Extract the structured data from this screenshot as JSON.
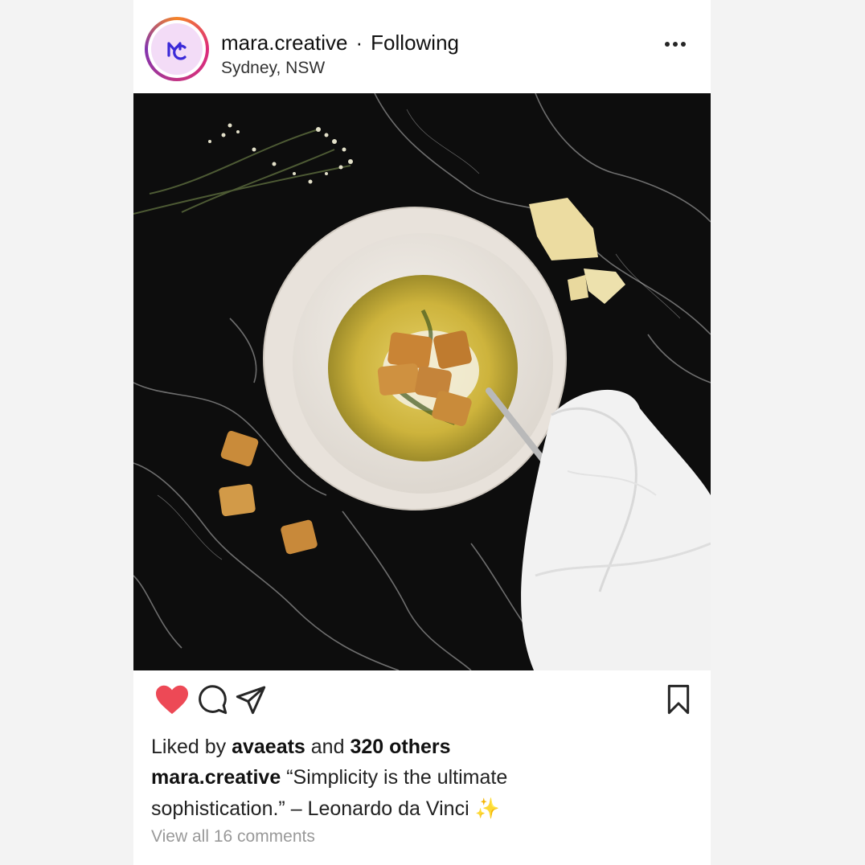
{
  "post": {
    "username": "mara.creative",
    "separator": "·",
    "follow_status": "Following",
    "location": "Sydney, NSW",
    "liked_by_prefix": "Liked by",
    "liked_by_user": "avaeats",
    "liked_by_and": "and",
    "liked_by_others": "320 others",
    "caption_user": "mara.creative",
    "caption_text_1": "“Simplicity is the ultimate",
    "caption_text_2": "sophistication.” – Leonardo da Vinci ✨",
    "view_comments": "View all 16 comments",
    "liked": true
  },
  "icons": {
    "more": "more-horizontal-icon",
    "like": "heart-filled-icon",
    "comment": "comment-icon",
    "share": "send-icon",
    "save": "bookmark-icon"
  },
  "colors": {
    "like_red": "#ed4956",
    "avatar_ring": "#dd2a7b",
    "avatar_logo": "#3b2ad8"
  },
  "image": {
    "description_icon": "food-photo"
  }
}
